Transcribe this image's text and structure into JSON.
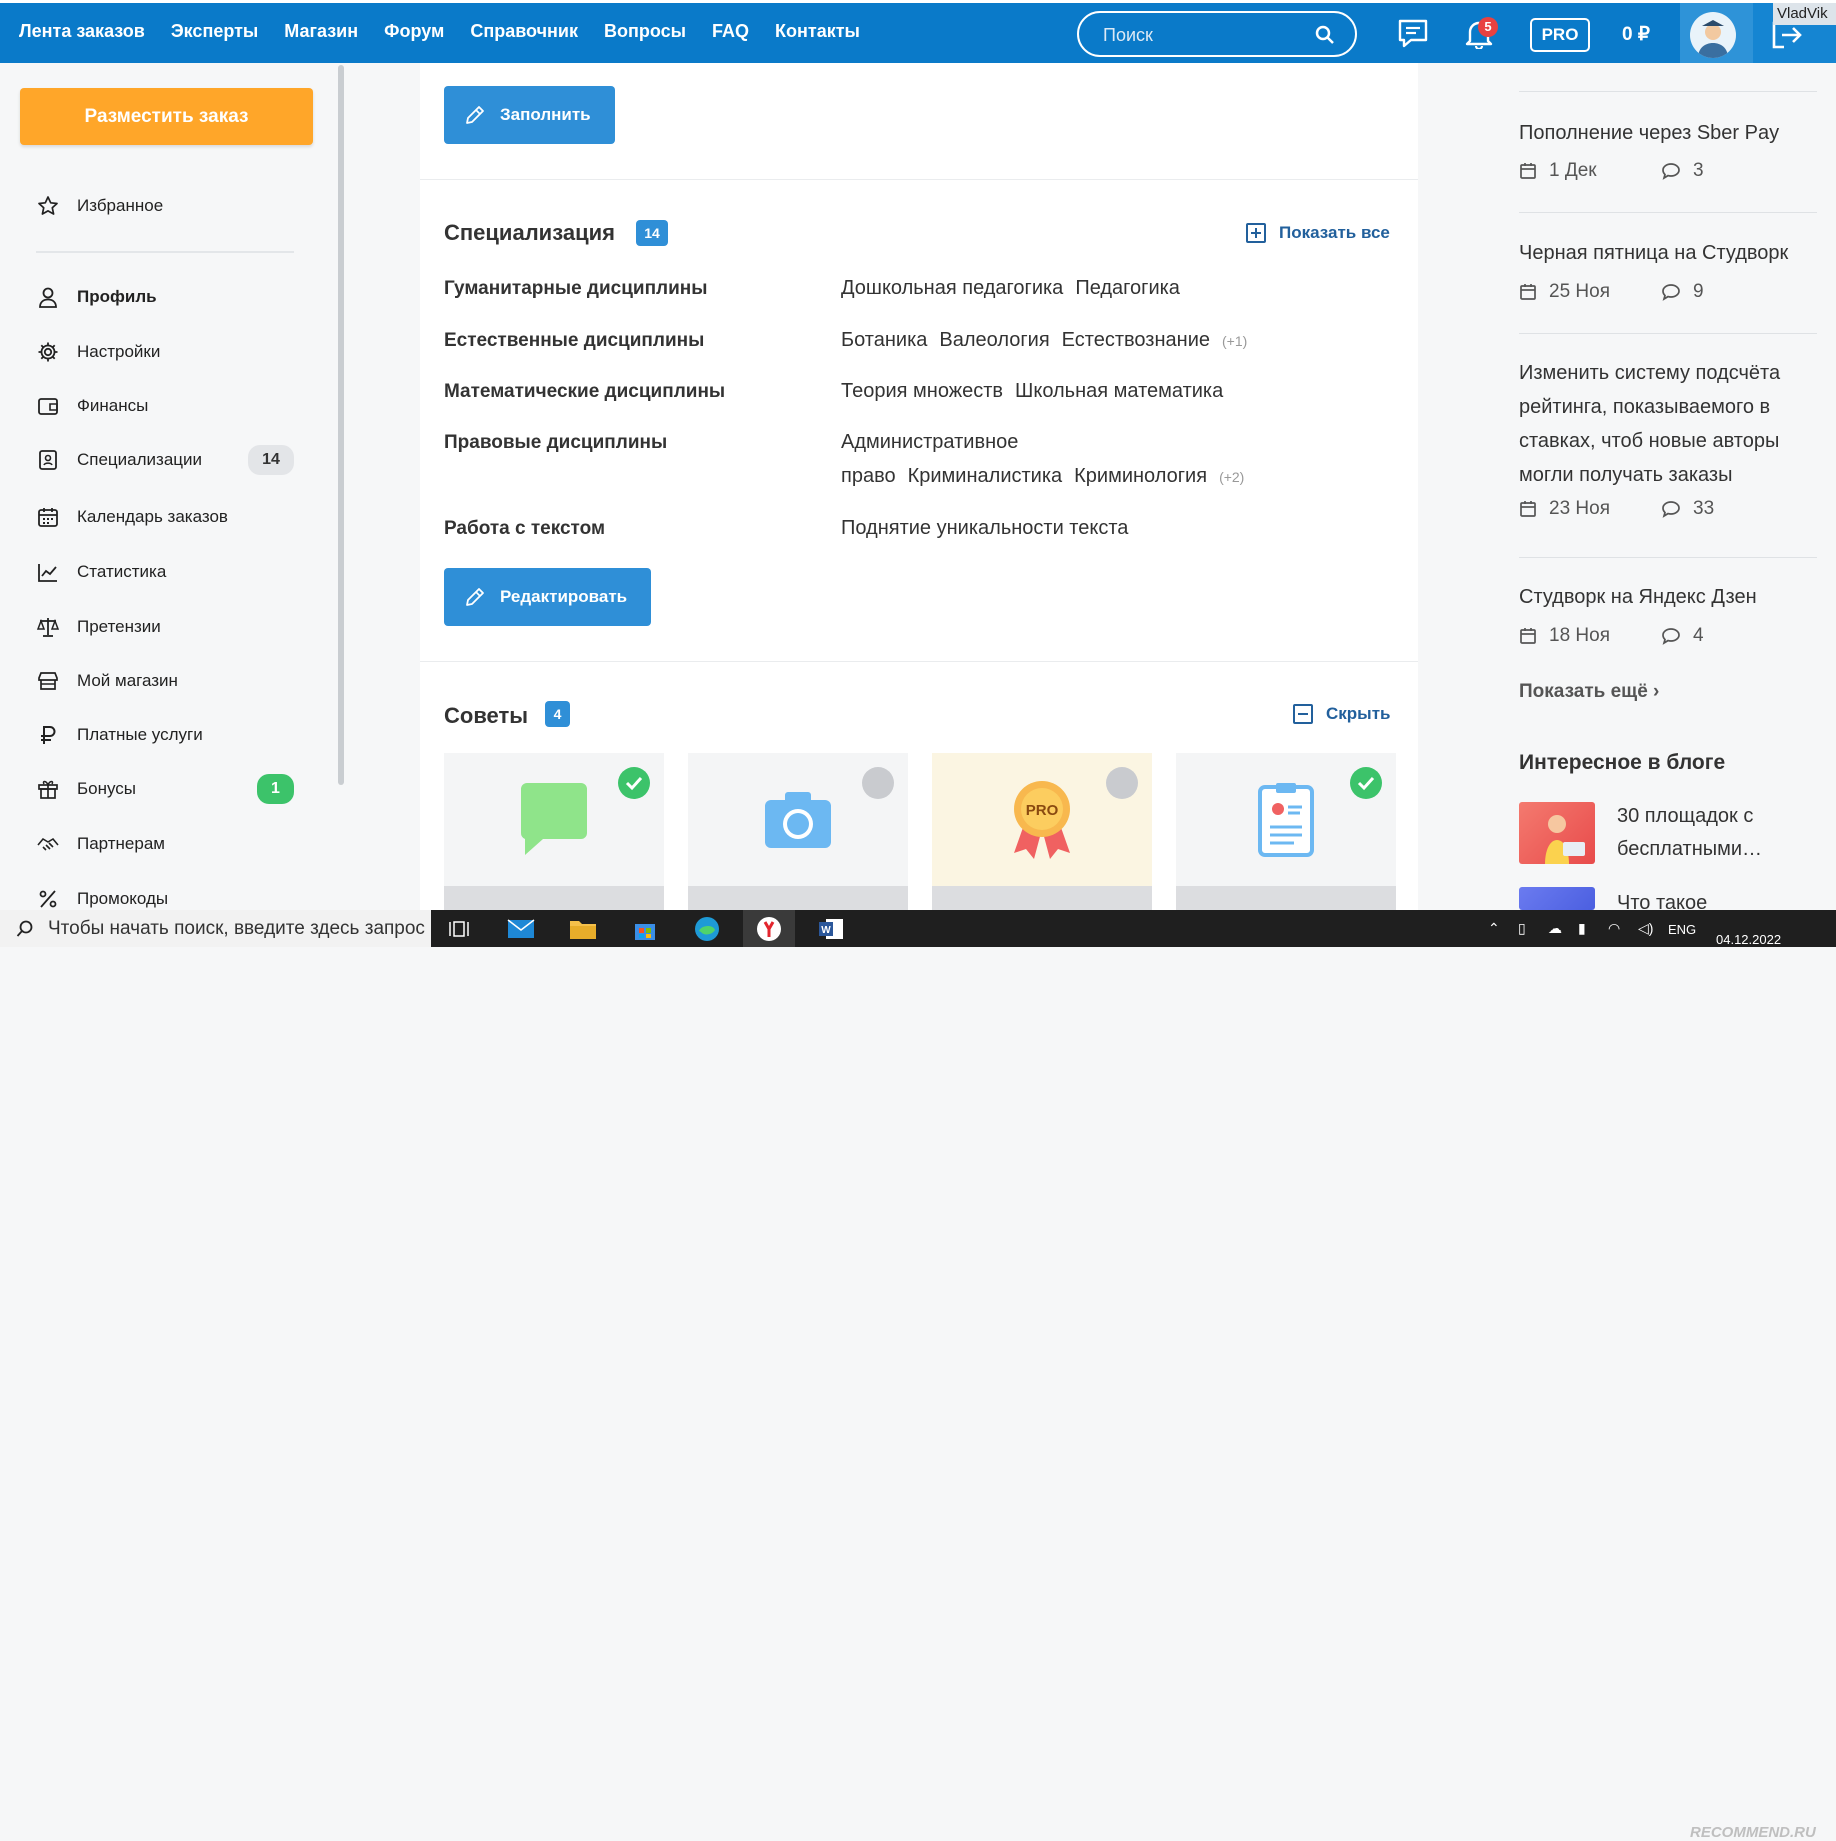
{
  "nav": {
    "items": [
      "Лента заказов",
      "Эксперты",
      "Магазин",
      "Форум",
      "Справочник",
      "Вопросы",
      "FAQ",
      "Контакты"
    ],
    "search_placeholder": "Поиск",
    "notifications_count": "5",
    "pro_label": "PRO",
    "balance": "0 ₽",
    "username": "VladVik"
  },
  "sidebar": {
    "order_button": "Разместить заказ",
    "favorites": "Избранное",
    "items": [
      {
        "label": "Профиль",
        "icon": "user-icon"
      },
      {
        "label": "Настройки",
        "icon": "gear-icon"
      },
      {
        "label": "Финансы",
        "icon": "wallet-icon"
      },
      {
        "label": "Специализации",
        "icon": "contact-card-icon",
        "badge": "14"
      },
      {
        "label": "Календарь заказов",
        "icon": "calendar-icon"
      },
      {
        "label": "Статистика",
        "icon": "chart-line-icon"
      },
      {
        "label": "Претензии",
        "icon": "scales-icon"
      },
      {
        "label": "Мой магазин",
        "icon": "store-icon"
      },
      {
        "label": "Платные услуги",
        "icon": "ruble-icon"
      },
      {
        "label": "Бонусы",
        "icon": "gift-icon",
        "badge": "1"
      },
      {
        "label": "Партнерам",
        "icon": "handshake-icon"
      },
      {
        "label": "Промокоды",
        "icon": "percent-icon"
      }
    ]
  },
  "main": {
    "fill_button": "Заполнить",
    "spec": {
      "title": "Специализация",
      "count": "14",
      "show_all": "Показать все",
      "categories": [
        {
          "name": "Гуманитарные дисциплины",
          "tags": [
            "Дошкольная педагогика",
            "Педагогика"
          ],
          "more": ""
        },
        {
          "name": "Естественные дисциплины",
          "tags": [
            "Ботаника",
            "Валеология",
            "Естествознание"
          ],
          "more": "(+1)"
        },
        {
          "name": "Математические дисциплины",
          "tags": [
            "Теория множеств",
            "Школьная математика"
          ],
          "more": ""
        },
        {
          "name": "Правовые дисциплины",
          "tags": [
            "Административное право",
            "Криминалистика",
            "Криминология"
          ],
          "more": "(+2)"
        },
        {
          "name": "Работа с текстом",
          "tags": [
            "Поднятие уникальности текста"
          ],
          "more": ""
        }
      ],
      "edit_button": "Редактировать"
    },
    "tips": {
      "title": "Советы",
      "count": "4",
      "hide": "Скрыть",
      "cards": [
        {
          "icon": "chat-bubble-icon",
          "done": true
        },
        {
          "icon": "camera-icon",
          "done": false
        },
        {
          "icon": "pro-medal-icon",
          "done": false,
          "medal_text": "PRO"
        },
        {
          "icon": "clipboard-profile-icon",
          "done": true
        }
      ]
    }
  },
  "right": {
    "news": [
      {
        "title": "Пополнение через Sber Pay",
        "date": "1 Дек",
        "comments": "3"
      },
      {
        "title": "Черная пятница на Студворк",
        "date": "25 Ноя",
        "comments": "9"
      },
      {
        "title": "Изменить систему подсчёта рейтинга, показываемого в ставках, чтоб новые авторы могли получать заказы",
        "date": "23 Ноя",
        "comments": "33"
      },
      {
        "title": "Студворк на Яндекс Дзен",
        "date": "18 Ноя",
        "comments": "4"
      }
    ],
    "show_more": "Показать ещё",
    "blog_title": "Интересное в блоге",
    "blog": [
      {
        "title": "30 площадок с бесплатными…"
      },
      {
        "title": "Что такое"
      }
    ]
  },
  "taskbar": {
    "search_text": "Чтобы начать поиск, введите здесь запрос",
    "lang": "ENG",
    "date": "04.12.2022",
    "watermark": "RECOMMEND.RU"
  },
  "colors": {
    "brand_blue": "#0a7ac9",
    "accent_orange": "#ffa629",
    "green": "#3cc36a"
  }
}
